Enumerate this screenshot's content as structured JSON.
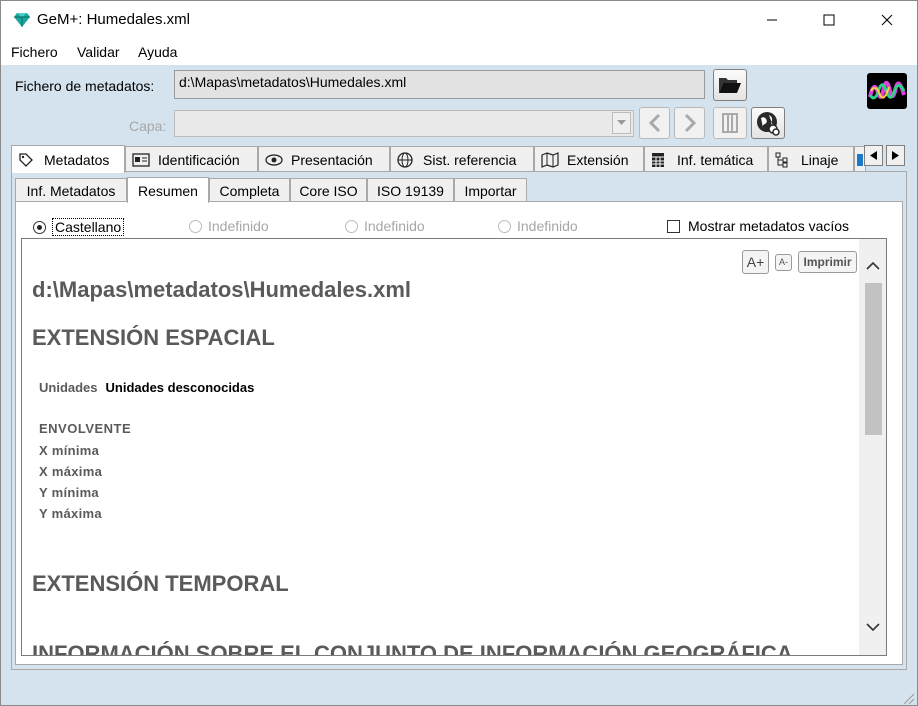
{
  "window": {
    "title": "GeM+: Humedales.xml",
    "icon": "gem-icon"
  },
  "menu": [
    "Fichero",
    "Validar",
    "Ayuda"
  ],
  "file": {
    "label": "Fichero de metadatos:",
    "value": "d:\\Mapas\\metadatos\\Humedales.xml",
    "layer_label": "Capa:",
    "layer_value": ""
  },
  "tabs": [
    {
      "label": "Metadatos",
      "icon": "tag-icon",
      "active": true
    },
    {
      "label": "Identificación",
      "icon": "id-card-icon"
    },
    {
      "label": "Presentación",
      "icon": "eye-icon"
    },
    {
      "label": "Sist. referencia",
      "icon": "globe-icon"
    },
    {
      "label": "Extensión",
      "icon": "map-icon"
    },
    {
      "label": "Inf. temática",
      "icon": "table-icon"
    },
    {
      "label": "Linaje",
      "icon": "tree-icon"
    }
  ],
  "subtabs": [
    "Inf. Metadatos",
    "Resumen",
    "Completa",
    "Core ISO",
    "ISO 19139",
    "Importar"
  ],
  "languages": [
    {
      "label": "Castellano",
      "selected": true
    },
    {
      "label": "Indefinido"
    },
    {
      "label": "Indefinido"
    },
    {
      "label": "Indefinido"
    }
  ],
  "show_empty_label": "Mostrar metadatos vacíos",
  "report": {
    "path": "d:\\Mapas\\metadatos\\Humedales.xml",
    "buttons": {
      "larger": "A+",
      "smaller": "A-",
      "print": "Imprimir"
    },
    "section_spatial": "EXTENSIÓN ESPACIAL",
    "units_label": "Unidades",
    "units_value": "Unidades desconocidas",
    "envelope_label": "ENVOLVENTE",
    "xmin_label": "X mínima",
    "xmax_label": "X máxima",
    "ymin_label": "Y mínima",
    "ymax_label": "Y máxima",
    "section_temporal": "EXTENSIÓN TEMPORAL",
    "section_info": "INFORMACIÓN SOBRE EL CONJUNTO DE INFORMACIÓN GEOGRÁFICA"
  }
}
